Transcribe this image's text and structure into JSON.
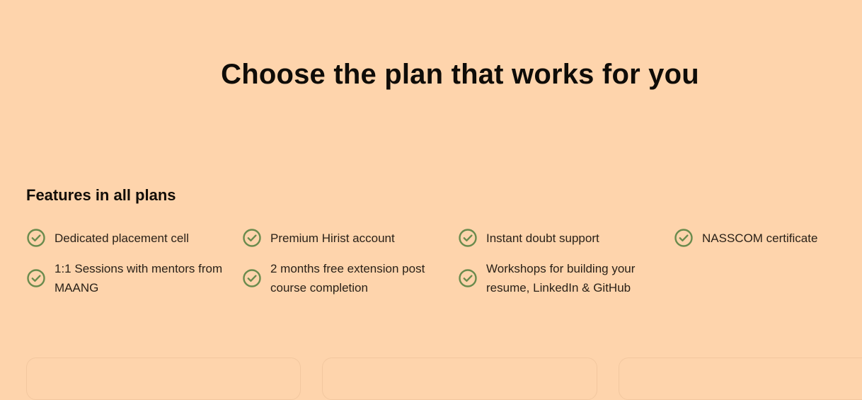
{
  "page": {
    "title": "Choose the plan that works for you"
  },
  "features": {
    "heading": "Features in all plans",
    "check_color": "#6a8b4d",
    "items": [
      {
        "label": "Dedicated placement cell",
        "icon": "check-circle-icon"
      },
      {
        "label": "Premium Hirist account",
        "icon": "check-circle-icon"
      },
      {
        "label": "Instant doubt support",
        "icon": "check-circle-icon"
      },
      {
        "label": "NASSCOM certificate",
        "icon": "check-circle-icon"
      },
      {
        "label": "1:1 Sessions with mentors from MAANG",
        "icon": "check-circle-icon"
      },
      {
        "label": "2 months free extension post course completion",
        "icon": "check-circle-icon"
      },
      {
        "label": "Workshops for building your resume, LinkedIn & GitHub",
        "icon": "check-circle-icon"
      }
    ]
  },
  "colors": {
    "background": "#fed4ac",
    "card_border": "#f2c79f"
  }
}
